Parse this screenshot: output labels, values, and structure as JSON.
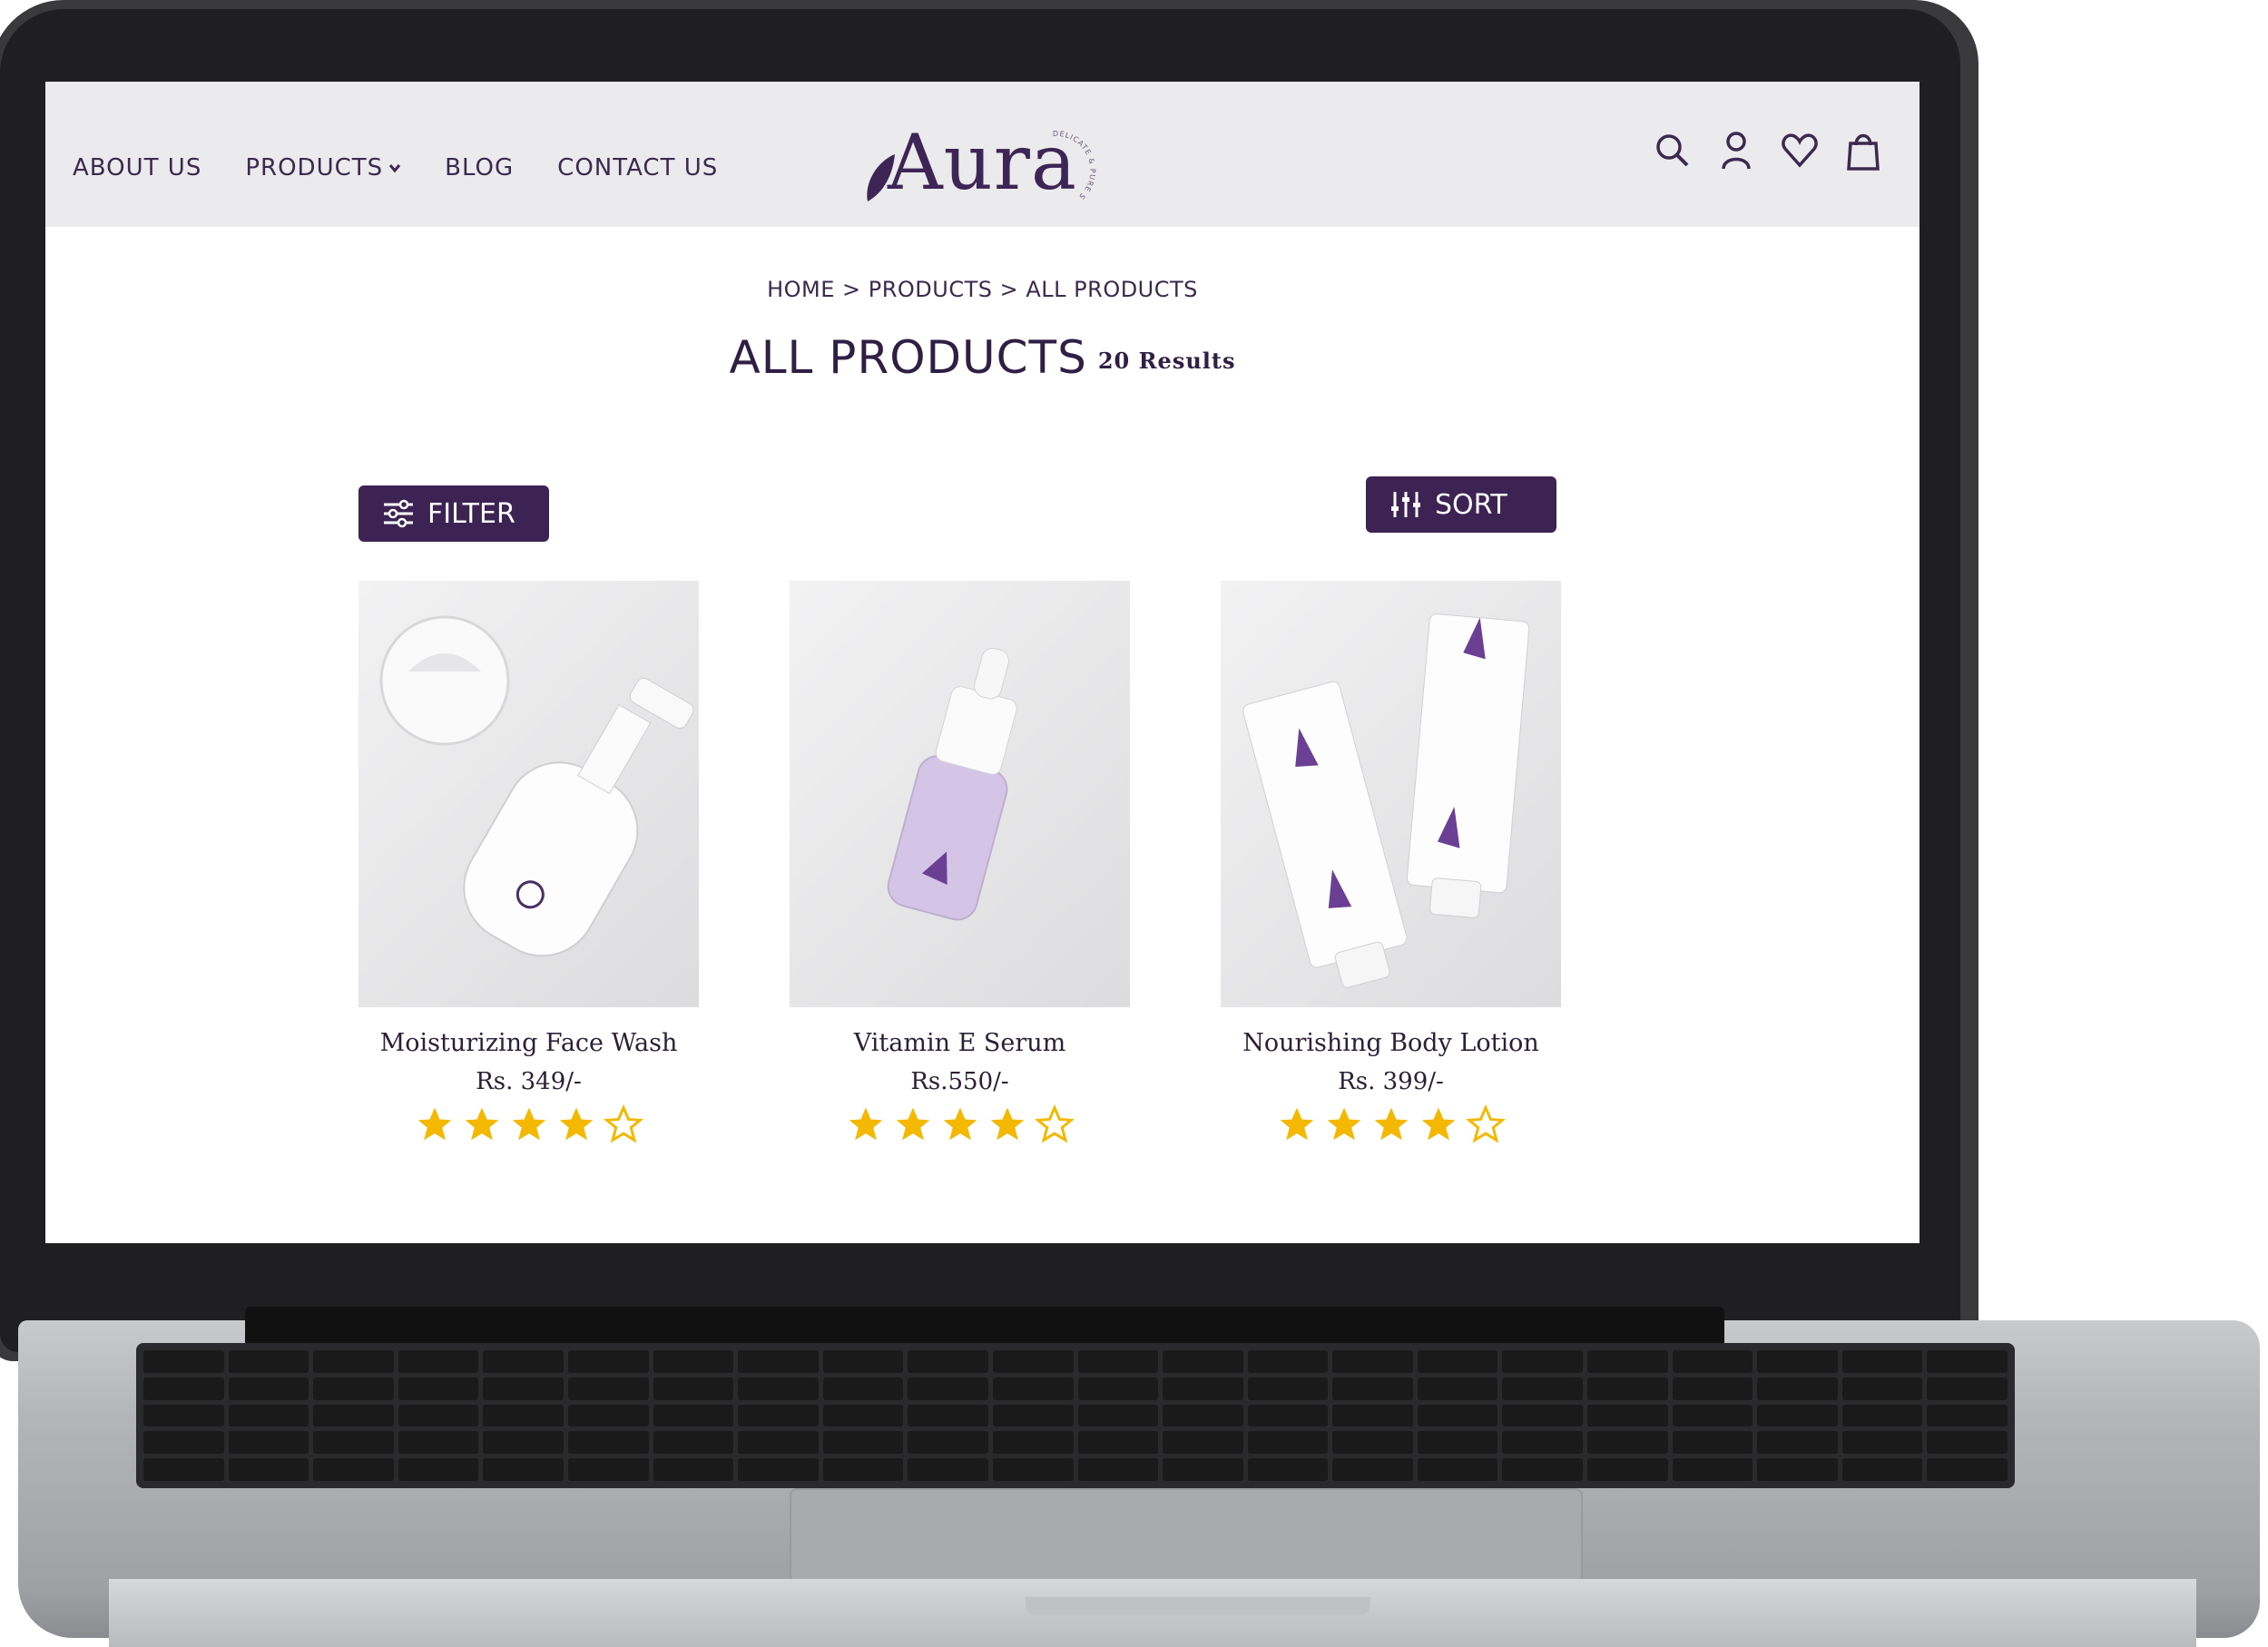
{
  "colors": {
    "brand_purple": "#3d2354",
    "nav_bg": "#ebebed",
    "star_gold": "#f5b800",
    "text_dark": "#2b2038"
  },
  "nav": {
    "links": [
      {
        "label": "ABOUT US"
      },
      {
        "label": "PRODUCTS"
      },
      {
        "label": "BLOG"
      },
      {
        "label": "CONTACT US"
      }
    ],
    "logo_text": "Aura",
    "logo_tagline": "DELICATE & PURE SKIN CARE",
    "icons": [
      "search-icon",
      "account-icon",
      "wishlist-icon",
      "cart-icon"
    ]
  },
  "breadcrumb": "HOME > PRODUCTS > ALL PRODUCTS",
  "page": {
    "title": "ALL PRODUCTS",
    "result_count": "20 Results"
  },
  "controls": {
    "filter_label": "FILTER",
    "sort_label": "SORT"
  },
  "products": [
    {
      "name": "Moisturizing Face Wash",
      "price": "Rs. 349/-",
      "rating": 4,
      "rating_max": 5,
      "image": "face-wash-bottle"
    },
    {
      "name": "Vitamin E Serum",
      "price": "Rs.550/-",
      "rating": 4,
      "rating_max": 5,
      "image": "serum-dropper-bottle"
    },
    {
      "name": "Nourishing Body Lotion",
      "price": "Rs. 399/-",
      "rating": 4,
      "rating_max": 5,
      "image": "lotion-tubes"
    }
  ]
}
